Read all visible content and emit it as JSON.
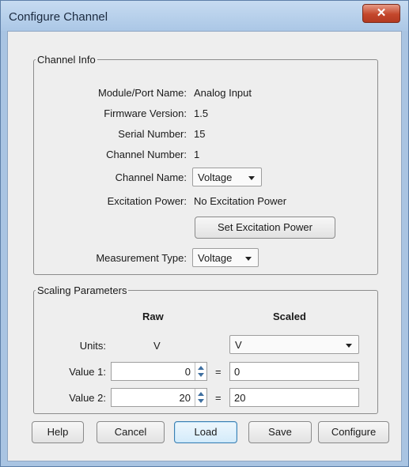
{
  "window": {
    "title": "Configure Channel",
    "close_glyph": "✕"
  },
  "channel_info": {
    "legend": "Channel Info",
    "module_label": "Module/Port Name:",
    "module_value": "Analog Input",
    "firmware_label": "Firmware Version:",
    "firmware_value": "1.5",
    "serial_label": "Serial Number:",
    "serial_value": "15",
    "channel_number_label": "Channel Number:",
    "channel_number_value": "1",
    "channel_name_label": "Channel Name:",
    "channel_name_value": "Voltage",
    "excitation_label": "Excitation Power:",
    "excitation_value": "No Excitation Power",
    "set_excitation_button": "Set Excitation Power",
    "measurement_label": "Measurement Type:",
    "measurement_value": "Voltage"
  },
  "scaling": {
    "legend": "Scaling Parameters",
    "raw_header": "Raw",
    "scaled_header": "Scaled",
    "units_label": "Units:",
    "units_raw": "V",
    "units_scaled": "V",
    "value1_label": "Value 1:",
    "value1_raw": "0",
    "value1_scaled": "0",
    "value2_label": "Value 2:",
    "value2_raw": "20",
    "value2_scaled": "20",
    "equals": "="
  },
  "buttons": {
    "help": "Help",
    "cancel": "Cancel",
    "load": "Load",
    "save": "Save",
    "configure": "Configure"
  }
}
